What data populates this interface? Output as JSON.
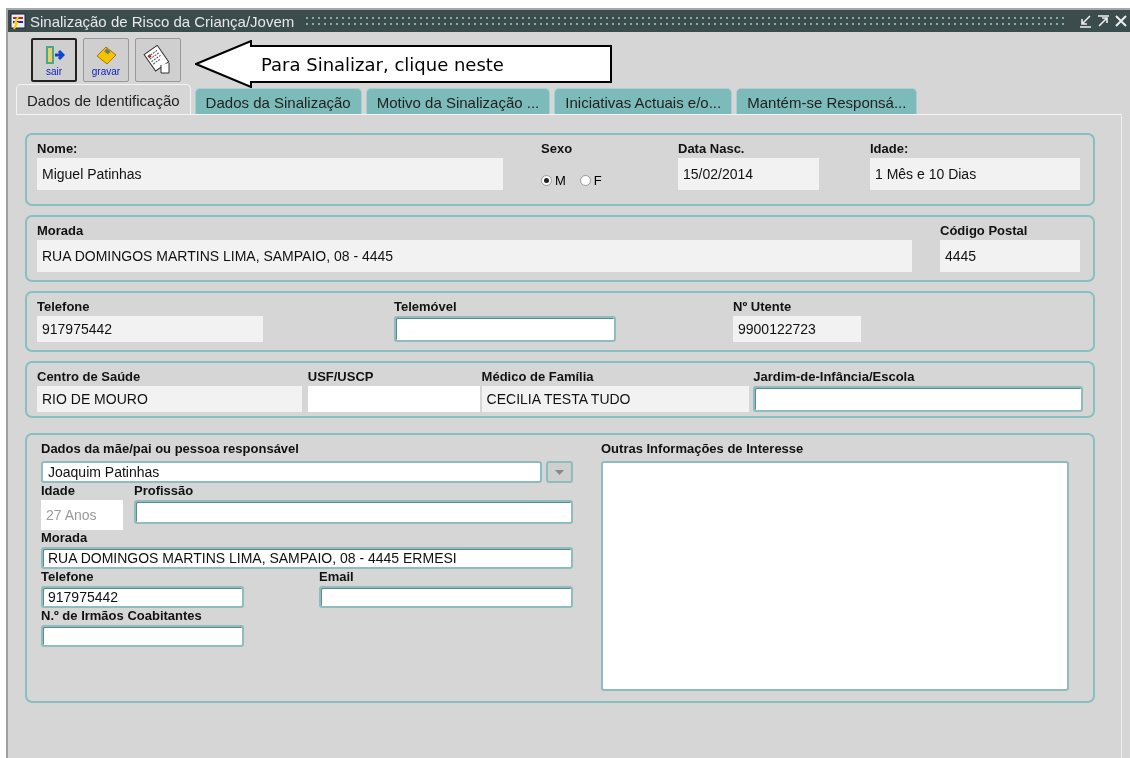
{
  "window": {
    "title": "Sinalização de Risco da Criança/Jovem"
  },
  "toolbar": {
    "buttons": [
      {
        "kind": "exit",
        "label": "sair"
      },
      {
        "kind": "save",
        "label": "gravar"
      },
      {
        "kind": "flag"
      }
    ]
  },
  "callout": {
    "text": "Para Sinalizar, clique neste"
  },
  "tabs": [
    {
      "label": "Dados de Identificação",
      "selected": true
    },
    {
      "label": "Dados da Sinalização",
      "selected": false
    },
    {
      "label": "Motivo da Sinalização ...",
      "selected": false
    },
    {
      "label": "Iniciativas Actuais e/o...",
      "selected": false
    },
    {
      "label": "Mantém-se Responsá...",
      "selected": false
    }
  ],
  "sections": [
    {
      "fields": [
        {
          "label": "Nome:",
          "value": "Miguel Patinhas",
          "kind": "display"
        },
        {
          "label": "Sexo",
          "kind": "radio",
          "options": [
            {
              "label": "M",
              "selected": true
            },
            {
              "label": "F",
              "selected": false
            }
          ]
        },
        {
          "label": "Data Nasc.",
          "value": "15/02/2014",
          "kind": "display"
        },
        {
          "label": "Idade:",
          "value": "1 Mês e 10 Dias",
          "kind": "display"
        }
      ]
    },
    {
      "fields": [
        {
          "label": "Morada",
          "value": "RUA DOMINGOS MARTINS LIMA, SAMPAIO, 08 - 4445",
          "kind": "display"
        },
        {
          "label": "Código Postal",
          "value": "4445",
          "kind": "display"
        }
      ]
    },
    {
      "fields": [
        {
          "label": "Telefone",
          "value": "917975442",
          "kind": "display"
        },
        {
          "label": "Telemóvel",
          "kind": "input"
        },
        {
          "label": "Nº Utente",
          "value": "9900122723",
          "kind": "display"
        }
      ]
    },
    {
      "fields": [
        {
          "label": "Centro de Saúde",
          "value": "RIO DE MOURO",
          "kind": "display"
        },
        {
          "label": "USF/USCP",
          "kind": "blank"
        },
        {
          "label": "Médico de Família",
          "value": "CECILIA TESTA TUDO",
          "kind": "display"
        },
        {
          "label": "Jardim-de-Infância/Escola",
          "kind": "input"
        }
      ]
    }
  ],
  "guardian": {
    "label": "Dados da mãe/pai ou pessoa responsável",
    "fields": [
      {
        "value": "Joaquim Patinhas",
        "kind": "combo"
      },
      {
        "label": "Idade",
        "value": "27 Anos",
        "kind": "disabled"
      },
      {
        "label": "Profissão",
        "kind": "input"
      },
      {
        "label": "Morada",
        "value": "RUA DOMINGOS MARTINS LIMA, SAMPAIO, 08 - 4445 ERMESI",
        "kind": "input"
      },
      {
        "label": "Telefone",
        "value": "917975442",
        "kind": "input"
      },
      {
        "label": "Email",
        "kind": "input"
      },
      {
        "label": "N.º de Irmãos Coabitantes",
        "kind": "input"
      }
    ]
  },
  "other_info": {
    "label": "Outras Informações de Interesse"
  }
}
